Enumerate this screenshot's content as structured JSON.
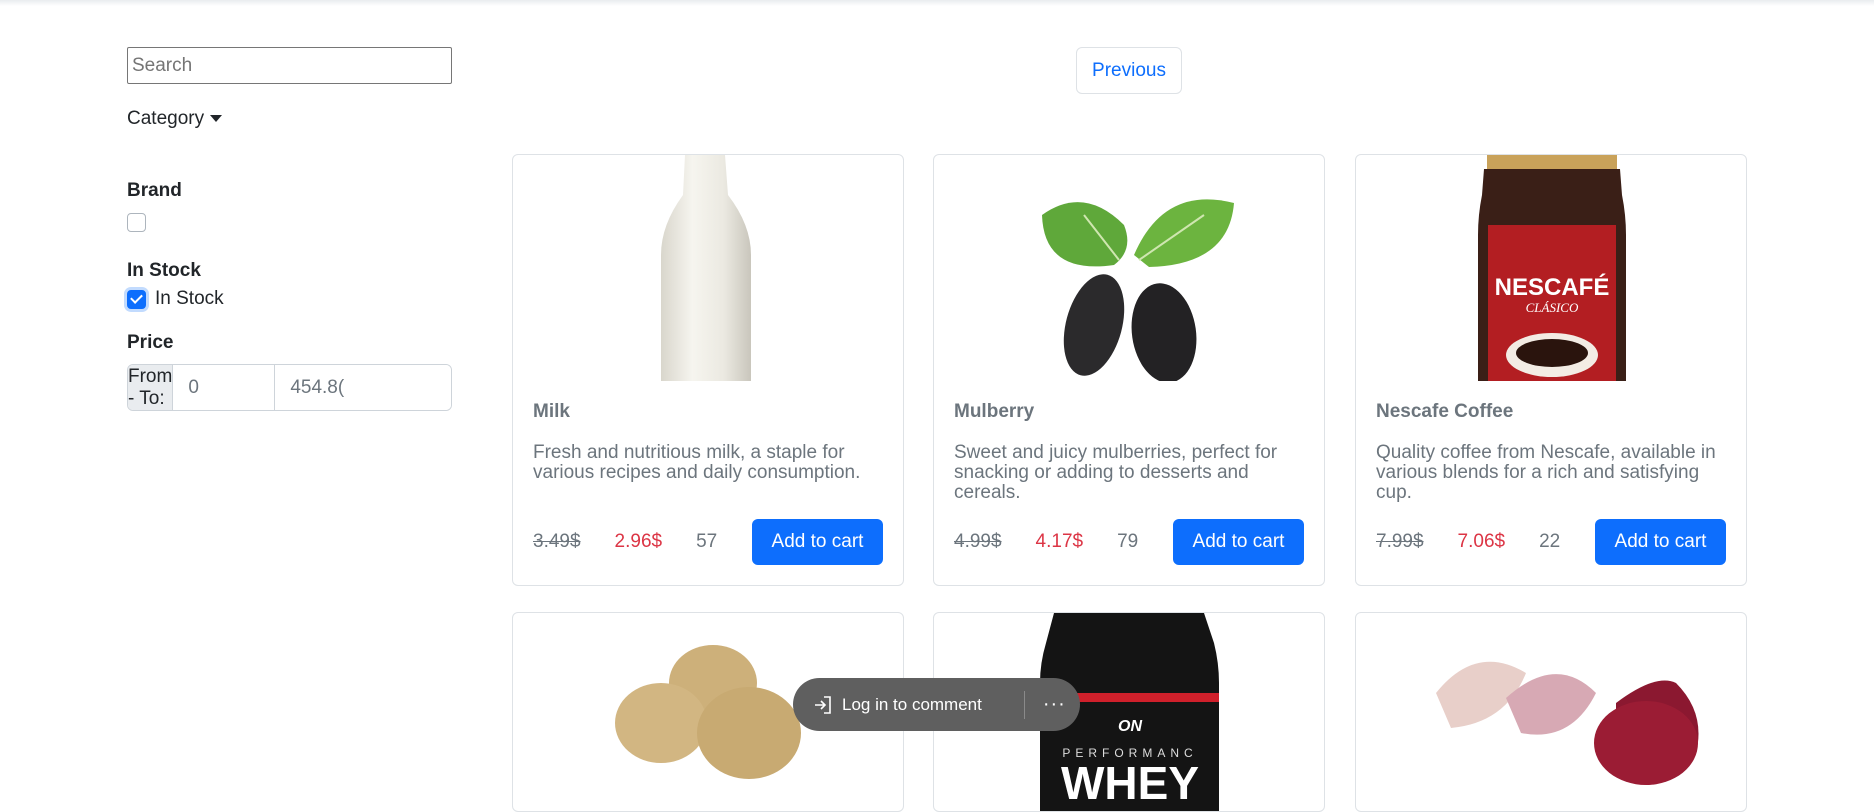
{
  "sidebar": {
    "search_placeholder": "Search",
    "category_label": "Category",
    "brand_label": "Brand",
    "instock_heading": "In Stock",
    "instock_checkbox_label": "In Stock",
    "instock_checked": true,
    "price_label": "Price",
    "price_prefix": "From - To:",
    "price_from": "0",
    "price_to": "454.8("
  },
  "pagination": {
    "previous_label": "Previous"
  },
  "products": [
    {
      "name": "Milk",
      "description": "Fresh and nutritious milk, a staple for various recipes and daily consumption.",
      "old_price": "3.49$",
      "price": "2.96$",
      "quantity": "57",
      "button": "Add to cart"
    },
    {
      "name": "Mulberry",
      "description": "Sweet and juicy mulberries, perfect for snacking or adding to desserts and cereals.",
      "old_price": "4.99$",
      "price": "4.17$",
      "quantity": "79",
      "button": "Add to cart"
    },
    {
      "name": "Nescafe Coffee",
      "description": "Quality coffee from Nescafe, available in various blends for a rich and satisfying cup.",
      "old_price": "7.99$",
      "price": "7.06$",
      "quantity": "22",
      "button": "Add to cart"
    }
  ],
  "image_text": {
    "nescafe_brand": "NESCAFÉ",
    "nescafe_variant": "CLÁSICO",
    "whey_brand": "ON",
    "whey_line": "PERFORMANC",
    "whey_word": "WHEY"
  },
  "comment_bar": {
    "text": "Log in to comment",
    "more": "···"
  },
  "colors": {
    "primary": "#0d6efd",
    "sale": "#dc3545",
    "muted": "#6c757d"
  }
}
